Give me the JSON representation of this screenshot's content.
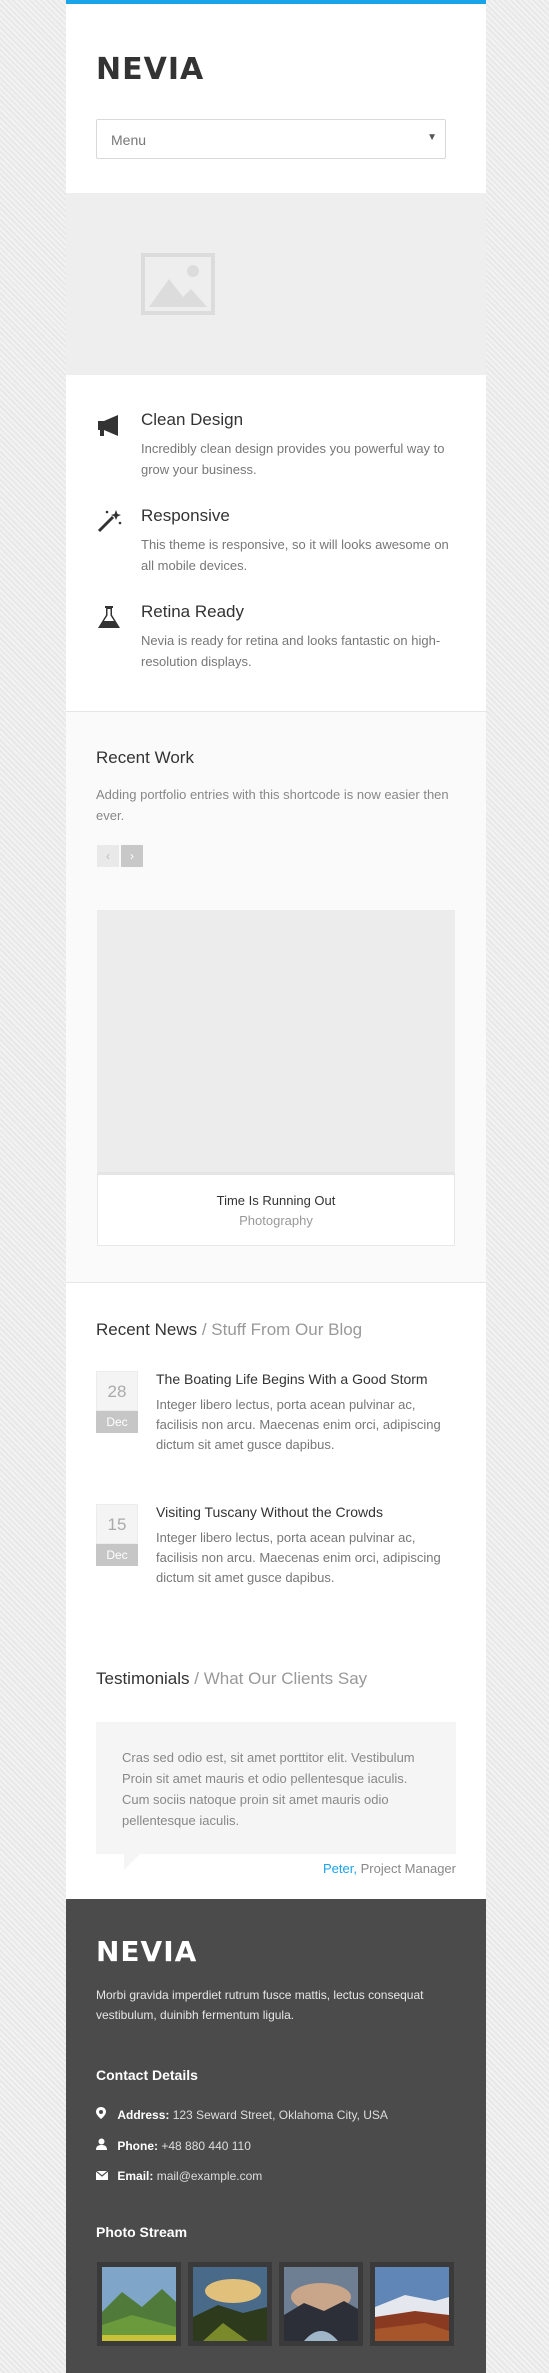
{
  "header": {
    "logo": "NEVIA",
    "menu_label": "Menu"
  },
  "features": [
    {
      "icon": "megaphone-icon",
      "title": "Clean Design",
      "text": "Incredibly clean design provides you powerful way to grow your business."
    },
    {
      "icon": "magic-wand-icon",
      "title": "Responsive",
      "text": "This theme is responsive, so it will looks awesome on all mobile devices."
    },
    {
      "icon": "flask-icon",
      "title": "Retina Ready",
      "text": "Nevia is ready for retina and looks fantastic on high-resolution displays."
    }
  ],
  "recent_work": {
    "title": "Recent Work",
    "description": "Adding portfolio entries with this shortcode is now easier then ever.",
    "prev_symbol": "‹",
    "next_symbol": "›",
    "item": {
      "title": "Time Is Running Out",
      "category": "Photography"
    }
  },
  "recent_news": {
    "title": "Recent News",
    "subtitle": "/ Stuff From Our Blog",
    "posts": [
      {
        "day": "28",
        "month": "Dec",
        "title": "The Boating Life Begins With a Good Storm",
        "excerpt": "Integer libero lectus, porta acean pulvinar ac, facilisis non arcu. Maecenas enim orci, adipiscing dictum sit amet gusce dapibus."
      },
      {
        "day": "15",
        "month": "Dec",
        "title": "Visiting Tuscany Without the Crowds",
        "excerpt": "Integer libero lectus, porta acean pulvinar ac, facilisis non arcu. Maecenas enim orci, adipiscing dictum sit amet gusce dapibus."
      }
    ]
  },
  "testimonials": {
    "title": "Testimonials",
    "subtitle": "/ What Our Clients Say",
    "quote": "Cras sed odio est, sit amet porttitor elit. Vestibulum Proin sit amet mauris et odio pellentesque iaculis. Cum sociis natoque proin sit amet mauris odio pellentesque iaculis.",
    "author_name": "Peter,",
    "author_role": "Project Manager"
  },
  "footer": {
    "logo": "NEVIA",
    "about": "Morbi gravida imperdiet rutrum fusce mattis, lectus consequat vestibulum, duinibh fermentum ligula.",
    "contact_title": "Contact Details",
    "contacts": [
      {
        "icon": "location-pin-icon",
        "label": "Address:",
        "value": "123 Seward Street, Oklahoma City, USA"
      },
      {
        "icon": "person-icon",
        "label": "Phone:",
        "value": "+48 880 440 110"
      },
      {
        "icon": "envelope-icon",
        "label": "Email:",
        "value": "mail@example.com"
      }
    ],
    "photo_stream_title": "Photo Stream"
  },
  "colors": {
    "accent": "#1aa3e8",
    "footer_bg": "#4b4b4b"
  }
}
